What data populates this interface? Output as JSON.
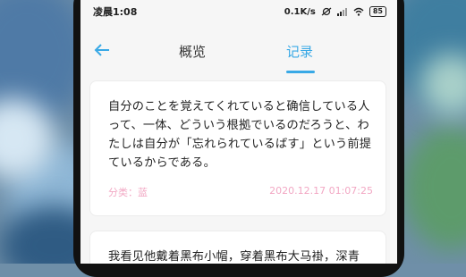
{
  "status_bar": {
    "time": "凌晨1:08",
    "network_speed": "0.1K/s",
    "battery": "85"
  },
  "nav": {
    "back_icon": "arrow-left-icon",
    "tabs": [
      {
        "label": "概览",
        "active": false
      },
      {
        "label": "记录",
        "active": true
      }
    ],
    "accent_color": "#39a9e6"
  },
  "records": [
    {
      "text": "自分のことを覚えてくれていると确信している人って、一体、どういう根拠でいるのだろうと、わたしは自分が「忘れられているばす」という前提ているからである。",
      "category": "分类：蓝",
      "timestamp": "2020.12.17 01:07:25"
    },
    {
      "text": "我看见他戴着黑布小帽，穿着黑布大马褂，深青"
    }
  ]
}
